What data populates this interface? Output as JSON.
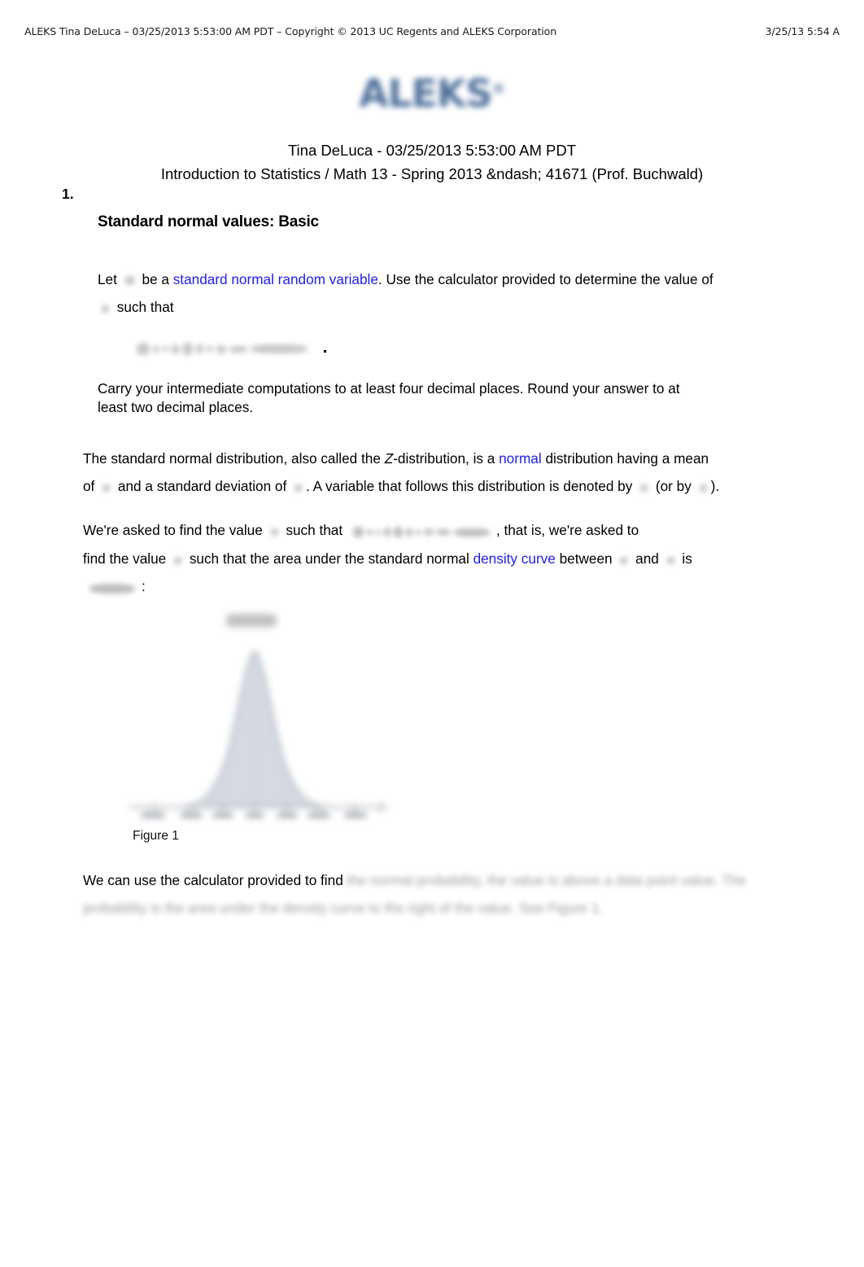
{
  "print_header": {
    "left": "ALEKS Tina DeLuca – 03/25/2013 5:53:00 AM PDT – Copyright © 2013 UC Regents and ALEKS Corporation",
    "right": "3/25/13 5:54 A"
  },
  "logo": {
    "text": "ALEKS",
    "trademark": "®",
    "color": "#3f6392"
  },
  "doc_title": {
    "line1": "Tina DeLuca - 03/25/2013 5:53:00 AM PDT",
    "line2": "Introduction to Statistics / Math 13 - Spring 2013 &ndash; 41671 (Prof. Buchwald)"
  },
  "question": {
    "number": "1.",
    "heading": "Standard normal values: Basic",
    "prompt": {
      "part1": "Let",
      "part2": "be a",
      "link": "standard normal random variable",
      "part3": ". Use the calculator provided to determine the value of",
      "part4": "such that"
    },
    "rounding_note": {
      "line1": "Carry your intermediate computations to at least four decimal places. Round your answer to at",
      "line2": "least two decimal places."
    },
    "explanation1": {
      "seg1": "The standard normal distribution, also called the",
      "italic": "Z",
      "seg2": "-distribution, is a",
      "link": "normal",
      "seg3": "distribution having a mean",
      "seg4": "of",
      "seg5": "and a standard deviation of",
      "seg6": ". A variable that follows this distribution is denoted by",
      "seg7": "(or by",
      "seg8": ")."
    },
    "explanation2": {
      "seg1": "We're asked to find the value",
      "seg2": "such that",
      "seg3": ", that is, we're asked to",
      "seg4": "find the value",
      "seg5": "such that the area under the standard normal",
      "link": "density curve",
      "seg6": "between",
      "seg7": "and",
      "seg8": "is",
      "seg9": ":"
    },
    "closing": {
      "visible_text": "We can use the calculator provided to find",
      "blurred_line1": "the normal probability, the value is above a data point",
      "blurred_line2": "value. The probability is the area under the density curve to the right of the value. See Figure 1."
    }
  },
  "figure": {
    "caption": "Figure 1",
    "label_above_peak": "",
    "curve_fill": "#d5dae1",
    "curve_stroke": "#a8b0bb",
    "axis_color": "#8e949c"
  },
  "colors": {
    "link": "#2020ee",
    "text": "#000000",
    "header_text": "#1a1a1a"
  }
}
